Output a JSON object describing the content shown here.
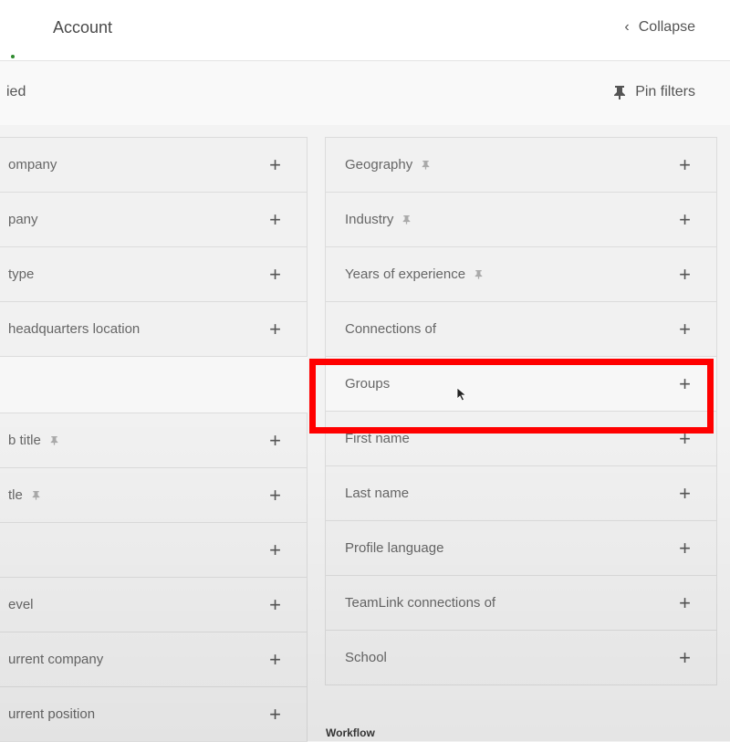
{
  "header": {
    "title": "Account",
    "collapse_label": "Collapse"
  },
  "subbar": {
    "applied_text": "ied",
    "pin_filters_label": "Pin filters"
  },
  "left_filters": [
    {
      "label": "ompany",
      "pinned": false
    },
    {
      "label": "pany",
      "pinned": false
    },
    {
      "label": "type",
      "pinned": false
    },
    {
      "label": "headquarters location",
      "pinned": false
    },
    {
      "label": "b title",
      "pinned": true
    },
    {
      "label": "tle",
      "pinned": true
    },
    {
      "label": "",
      "pinned": false
    },
    {
      "label": "evel",
      "pinned": false
    },
    {
      "label": "urrent company",
      "pinned": false
    },
    {
      "label": "urrent position",
      "pinned": false
    }
  ],
  "right_filters": [
    {
      "label": "Geography",
      "pinned": true
    },
    {
      "label": "Industry",
      "pinned": true
    },
    {
      "label": "Years of experience",
      "pinned": true
    },
    {
      "label": "Connections of",
      "pinned": false
    },
    {
      "label": "Groups",
      "pinned": false
    },
    {
      "label": "First name",
      "pinned": false
    },
    {
      "label": "Last name",
      "pinned": false
    },
    {
      "label": "Profile language",
      "pinned": false
    },
    {
      "label": "TeamLink connections of",
      "pinned": false
    },
    {
      "label": "School",
      "pinned": false
    }
  ],
  "plus_symbol": "+",
  "footer": {
    "workflow_label": "Workflow"
  },
  "colors": {
    "highlight": "#ff0000",
    "accent_dot": "#2e8b2e"
  },
  "icons": {
    "pin": "pin-icon",
    "collapse": "chevron-left-icon",
    "cursor": "mouse-pointer-icon"
  }
}
